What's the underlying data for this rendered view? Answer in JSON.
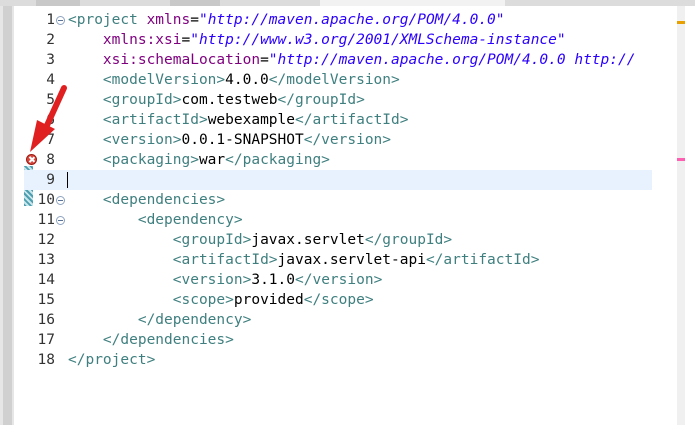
{
  "editor": {
    "lines": [
      {
        "num": "1",
        "tokens": [
          [
            "t",
            "<project "
          ],
          [
            "a",
            "xmlns"
          ],
          [
            "p",
            "="
          ],
          [
            "v",
            "\"http://maven.apache.org/POM/4.0.0\""
          ]
        ],
        "fold": true
      },
      {
        "num": "2",
        "tokens": [
          [
            "p",
            "    "
          ],
          [
            "a",
            "xmlns:xsi"
          ],
          [
            "p",
            "="
          ],
          [
            "v",
            "\"http://www.w3.org/2001/XMLSchema-instance\""
          ]
        ]
      },
      {
        "num": "3",
        "tokens": [
          [
            "p",
            "    "
          ],
          [
            "a",
            "xsi:schemaLocation"
          ],
          [
            "p",
            "="
          ],
          [
            "v",
            "\"http://maven.apache.org/POM/4.0.0 http://"
          ]
        ]
      },
      {
        "num": "4",
        "tokens": [
          [
            "p",
            "    "
          ],
          [
            "t",
            "<modelVersion>"
          ],
          [
            "p",
            "4.0.0"
          ],
          [
            "t",
            "</modelVersion>"
          ]
        ]
      },
      {
        "num": "5",
        "tokens": [
          [
            "p",
            "    "
          ],
          [
            "t",
            "<groupId>"
          ],
          [
            "p",
            "com.testweb"
          ],
          [
            "t",
            "</groupId>"
          ]
        ]
      },
      {
        "num": "6",
        "tokens": [
          [
            "p",
            "    "
          ],
          [
            "t",
            "<artifactId>"
          ],
          [
            "p",
            "webexample"
          ],
          [
            "t",
            "</artifactId>"
          ]
        ]
      },
      {
        "num": "7",
        "tokens": [
          [
            "p",
            "    "
          ],
          [
            "t",
            "<version>"
          ],
          [
            "p",
            "0.0.1-SNAPSHOT"
          ],
          [
            "t",
            "</version>"
          ]
        ]
      },
      {
        "num": "8",
        "tokens": [
          [
            "p",
            "    "
          ],
          [
            "t",
            "<packaging>"
          ],
          [
            "p",
            "war"
          ],
          [
            "t",
            "</packaging>"
          ]
        ],
        "error": true
      },
      {
        "num": "9",
        "tokens": [],
        "current": true
      },
      {
        "num": "10",
        "tokens": [
          [
            "p",
            "    "
          ],
          [
            "t",
            "<dependencies>"
          ]
        ],
        "fold": true
      },
      {
        "num": "11",
        "tokens": [
          [
            "p",
            "        "
          ],
          [
            "t",
            "<dependency>"
          ]
        ],
        "fold": true
      },
      {
        "num": "12",
        "tokens": [
          [
            "p",
            "            "
          ],
          [
            "t",
            "<groupId>"
          ],
          [
            "p",
            "javax.servlet"
          ],
          [
            "t",
            "</groupId>"
          ]
        ]
      },
      {
        "num": "13",
        "tokens": [
          [
            "p",
            "            "
          ],
          [
            "t",
            "<artifactId>"
          ],
          [
            "p",
            "javax.servlet-api"
          ],
          [
            "t",
            "</artifactId>"
          ]
        ]
      },
      {
        "num": "14",
        "tokens": [
          [
            "p",
            "            "
          ],
          [
            "t",
            "<version>"
          ],
          [
            "p",
            "3.1.0"
          ],
          [
            "t",
            "</version>"
          ]
        ]
      },
      {
        "num": "15",
        "tokens": [
          [
            "p",
            "            "
          ],
          [
            "t",
            "<scope>"
          ],
          [
            "p",
            "provided"
          ],
          [
            "t",
            "</scope>"
          ]
        ]
      },
      {
        "num": "16",
        "tokens": [
          [
            "p",
            "        "
          ],
          [
            "t",
            "</dependency>"
          ]
        ]
      },
      {
        "num": "17",
        "tokens": [
          [
            "p",
            "    "
          ],
          [
            "t",
            "</dependencies>"
          ]
        ]
      },
      {
        "num": "18",
        "tokens": [
          [
            "t",
            "</project>"
          ]
        ]
      }
    ]
  },
  "colors": {
    "tag": "#3f7f7f",
    "attribute": "#7f007f",
    "value": "#2a00ff",
    "current_line": "#e8f2fe",
    "error": "#d8463c",
    "annotation_arrow": "#e02020",
    "overview_error": "#ff5fb0",
    "overview_warning": "#e8a000"
  },
  "icons": {
    "error": "error-marker-icon",
    "fold": "fold-collapse-icon",
    "arrow": "red-annotation-arrow"
  }
}
